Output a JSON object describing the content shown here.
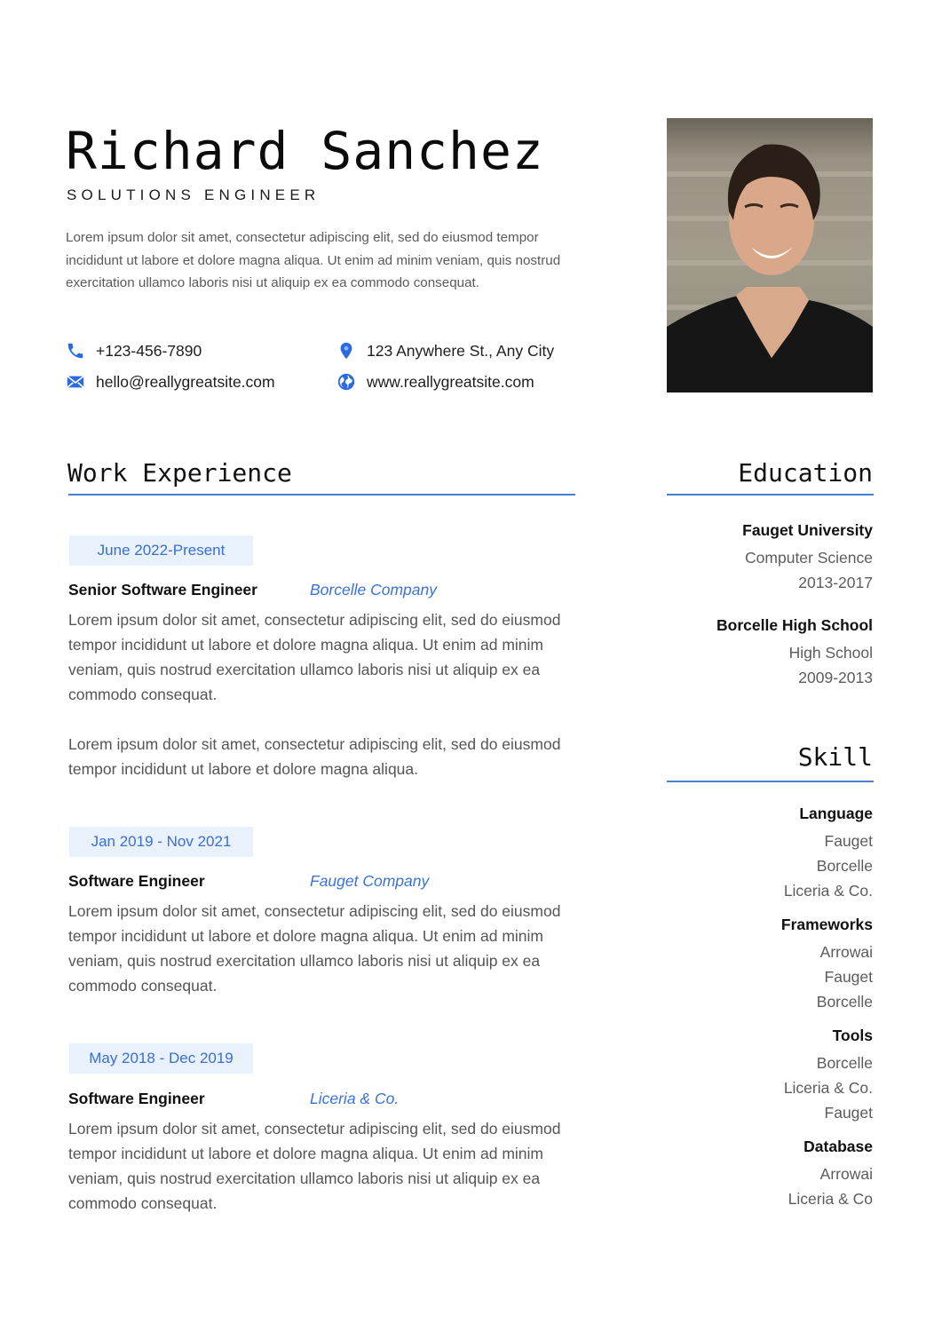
{
  "header": {
    "name": "Richard Sanchez",
    "role": "SOLUTIONS ENGINEER",
    "summary": "Lorem ipsum dolor sit amet, consectetur adipiscing elit, sed do eiusmod tempor incididunt ut labore et dolore magna aliqua. Ut enim ad minim veniam, quis nostrud exercitation ullamco laboris nisi ut aliquip ex ea commodo consequat."
  },
  "contact": {
    "phone": {
      "icon": "phone-icon",
      "value": "+123-456-7890"
    },
    "email": {
      "icon": "mail-icon",
      "value": "hello@reallygreatsite.com"
    },
    "address": {
      "icon": "location-pin-icon",
      "value": "123 Anywhere St., Any City"
    },
    "website": {
      "icon": "globe-icon",
      "value": "www.reallygreatsite.com"
    }
  },
  "colors": {
    "accent": "#3a72d8",
    "pill_bg": "#e9f1fd",
    "rule": "#4a7fd0"
  },
  "work": {
    "title": "Work Experience",
    "jobs": [
      {
        "date": "June 2022-Present",
        "title": "Senior Software Engineer",
        "company": "Borcelle Company",
        "paragraphs": [
          "Lorem ipsum dolor sit amet, consectetur adipiscing elit, sed do eiusmod tempor incididunt ut labore et dolore magna aliqua. Ut enim ad minim veniam, quis nostrud exercitation ullamco laboris nisi ut aliquip ex ea commodo consequat.",
          "Lorem ipsum dolor sit amet, consectetur adipiscing elit, sed do eiusmod tempor incididunt ut labore et dolore magna aliqua."
        ]
      },
      {
        "date": "Jan 2019 - Nov 2021",
        "title": "Software Engineer",
        "company": "Fauget Company",
        "paragraphs": [
          "Lorem ipsum dolor sit amet, consectetur adipiscing elit, sed do eiusmod tempor incididunt ut labore et dolore magna aliqua. Ut enim ad minim veniam, quis nostrud exercitation ullamco laboris nisi ut aliquip ex ea commodo consequat."
        ]
      },
      {
        "date": "May 2018 - Dec 2019",
        "title": "Software Engineer",
        "company": "Liceria & Co.",
        "paragraphs": [
          "Lorem ipsum dolor sit amet, consectetur adipiscing elit, sed do eiusmod tempor incididunt ut labore et dolore magna aliqua. Ut enim ad minim veniam, quis nostrud exercitation ullamco laboris nisi ut aliquip ex ea commodo consequat."
        ]
      }
    ]
  },
  "education": {
    "title": "Education",
    "entries": [
      {
        "school": "Fauget University",
        "field": "Computer Science",
        "years": "2013-2017"
      },
      {
        "school": "Borcelle High School",
        "field": "High School",
        "years": "2009-2013"
      }
    ]
  },
  "skill": {
    "title": "Skill",
    "groups": [
      {
        "name": "Language",
        "items": [
          "Fauget",
          "Borcelle",
          "Liceria & Co."
        ]
      },
      {
        "name": "Frameworks",
        "items": [
          "Arrowai",
          "Fauget",
          "Borcelle"
        ]
      },
      {
        "name": "Tools",
        "items": [
          "Borcelle",
          "Liceria & Co.",
          "Fauget"
        ]
      },
      {
        "name": "Database",
        "items": [
          "Arrowai",
          "Liceria & Co"
        ]
      }
    ]
  },
  "photo": {
    "alt": "Portrait photo of Richard Sanchez"
  }
}
